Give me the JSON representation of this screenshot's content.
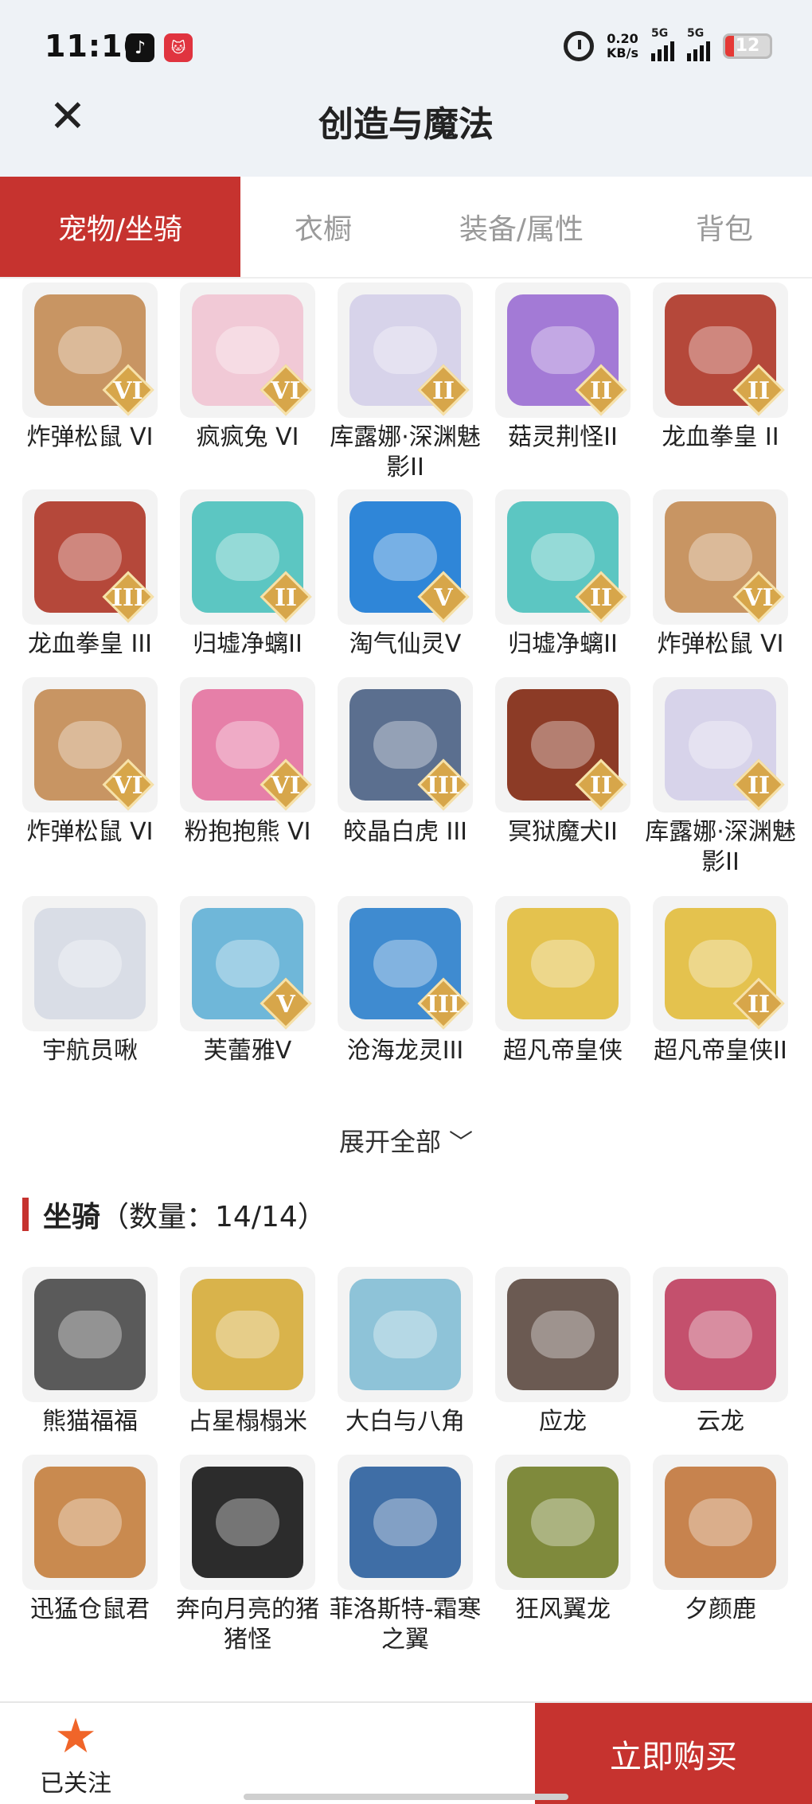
{
  "status_bar": {
    "time": "11:16",
    "net_speed_value": "0.20",
    "net_speed_unit": "KB/s",
    "signal1": "5G",
    "signal2": "5G",
    "battery": "12"
  },
  "header": {
    "title": "创造与魔法"
  },
  "tabs": [
    {
      "label": "宠物/坐骑",
      "active": true
    },
    {
      "label": "衣橱",
      "active": false
    },
    {
      "label": "装备/属性",
      "active": false
    },
    {
      "label": "背包",
      "active": false
    }
  ],
  "pets": [
    {
      "name": "炸弹松鼠 VI",
      "badge": "VI",
      "color": "#c89563"
    },
    {
      "name": "疯疯兔 VI",
      "badge": "VI",
      "color": "#f1c9d6"
    },
    {
      "name": "库露娜·深渊魅影II",
      "badge": "II",
      "color": "#d7d3ea"
    },
    {
      "name": "菇灵荆怪II",
      "badge": "II",
      "color": "#a37ad6"
    },
    {
      "name": "龙血拳皇 II",
      "badge": "II",
      "color": "#b5483a"
    },
    {
      "name": "龙血拳皇 III",
      "badge": "III",
      "color": "#b5483a"
    },
    {
      "name": "归墟净螭II",
      "badge": "II",
      "color": "#5cc6c2"
    },
    {
      "name": "淘气仙灵V",
      "badge": "V",
      "color": "#2f86d8"
    },
    {
      "name": "归墟净螭II",
      "badge": "II",
      "color": "#5cc6c2"
    },
    {
      "name": "炸弹松鼠 VI",
      "badge": "VI",
      "color": "#c89563"
    },
    {
      "name": "炸弹松鼠 VI",
      "badge": "VI",
      "color": "#c89563"
    },
    {
      "name": "粉抱抱熊 VI",
      "badge": "VI",
      "color": "#e67fa8"
    },
    {
      "name": "皎晶白虎 III",
      "badge": "III",
      "color": "#5b6f8f"
    },
    {
      "name": "冥狱魔犬II",
      "badge": "II",
      "color": "#8c3b26"
    },
    {
      "name": "库露娜·深渊魅影II",
      "badge": "II",
      "color": "#d7d3ea"
    },
    {
      "name": "宇航员啾",
      "badge": "",
      "color": "#d9dde6"
    },
    {
      "name": "芙蕾雅V",
      "badge": "V",
      "color": "#6fb7d9"
    },
    {
      "name": "沧海龙灵III",
      "badge": "III",
      "color": "#3f8bd0"
    },
    {
      "name": "超凡帝皇侠",
      "badge": "",
      "color": "#e4c24e"
    },
    {
      "name": "超凡帝皇侠II",
      "badge": "II",
      "color": "#e4c24e"
    }
  ],
  "expand_label": "展开全部",
  "mounts_section": {
    "title": "坐骑",
    "count": "（数量：14/14）"
  },
  "mounts": [
    {
      "name": "熊猫福福",
      "color": "#5a5a5a"
    },
    {
      "name": "占星榻榻米",
      "color": "#d9b34b"
    },
    {
      "name": "大白与八角",
      "color": "#8ec3d8"
    },
    {
      "name": "应龙",
      "color": "#6b5a52"
    },
    {
      "name": "云龙",
      "color": "#c4506d"
    },
    {
      "name": "迅猛仓鼠君",
      "color": "#c98a4f"
    },
    {
      "name": "奔向月亮的猪猪怪",
      "color": "#2c2c2c"
    },
    {
      "name": "菲洛斯特-霜寒之翼",
      "color": "#3f6ea6"
    },
    {
      "name": "狂风翼龙",
      "color": "#7f8a3c"
    },
    {
      "name": "夕颜鹿",
      "color": "#c7834e"
    }
  ],
  "bottom_bar": {
    "follow_label": "已关注",
    "buy_label": "立即购买"
  }
}
